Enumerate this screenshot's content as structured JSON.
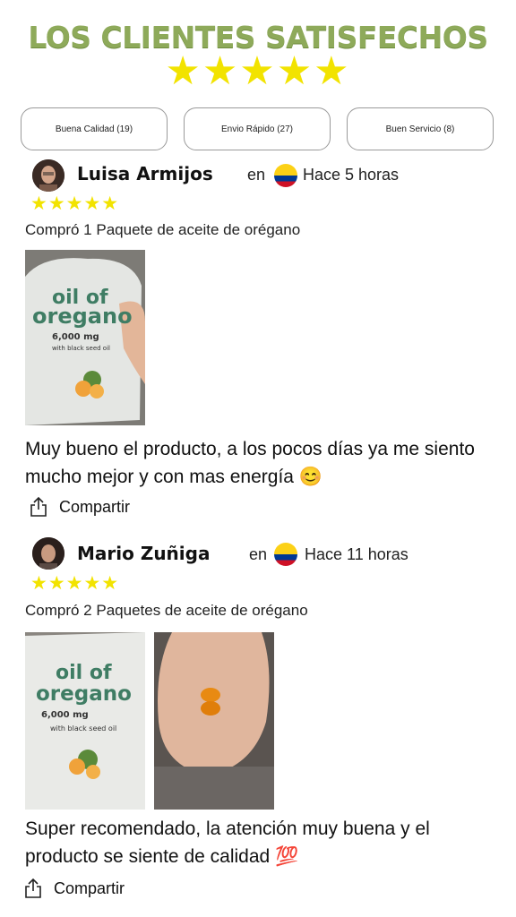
{
  "header": {
    "title": "LOS CLIENTES SATISFECHOS",
    "stars": "★★★★★"
  },
  "filters": [
    {
      "label": "Buena Calidad (19)"
    },
    {
      "label": "Envio Rápido (27)"
    },
    {
      "label": "Buen Servicio (8)"
    }
  ],
  "reviews": [
    {
      "name": "Luisa Armijos",
      "en": "en",
      "time": "Hace 5 horas",
      "stars": "★★★★★",
      "rating": 5,
      "bought": "Compró 1 Paquete de aceite de orégano",
      "comment": "Muy bueno el producto, a los pocos días ya me siento mucho mejor y con mas energía 😊",
      "share": "Compartir"
    },
    {
      "name": "Mario Zuñiga",
      "en": "en",
      "time": "Hace 11 horas",
      "stars": "★★★★★",
      "rating": 5,
      "bought": "Compró 2 Paquetes de aceite de orégano",
      "comment": "Super recomendado, la atención muy buena y el producto se siente de calidad 💯",
      "share": "Compartir"
    }
  ],
  "product": {
    "line1": "oil of",
    "line2": "oregano",
    "dose": "6,000 mg",
    "seed": "with black seed oil"
  },
  "colors": {
    "title_green": "#8eaa5a",
    "star_yellow": "#f2e300",
    "flag_yellow": "#fcd116",
    "flag_blue": "#003893",
    "flag_red": "#ce1126"
  },
  "icons": [
    "star-icon",
    "share-icon",
    "colombia-flag-icon"
  ]
}
